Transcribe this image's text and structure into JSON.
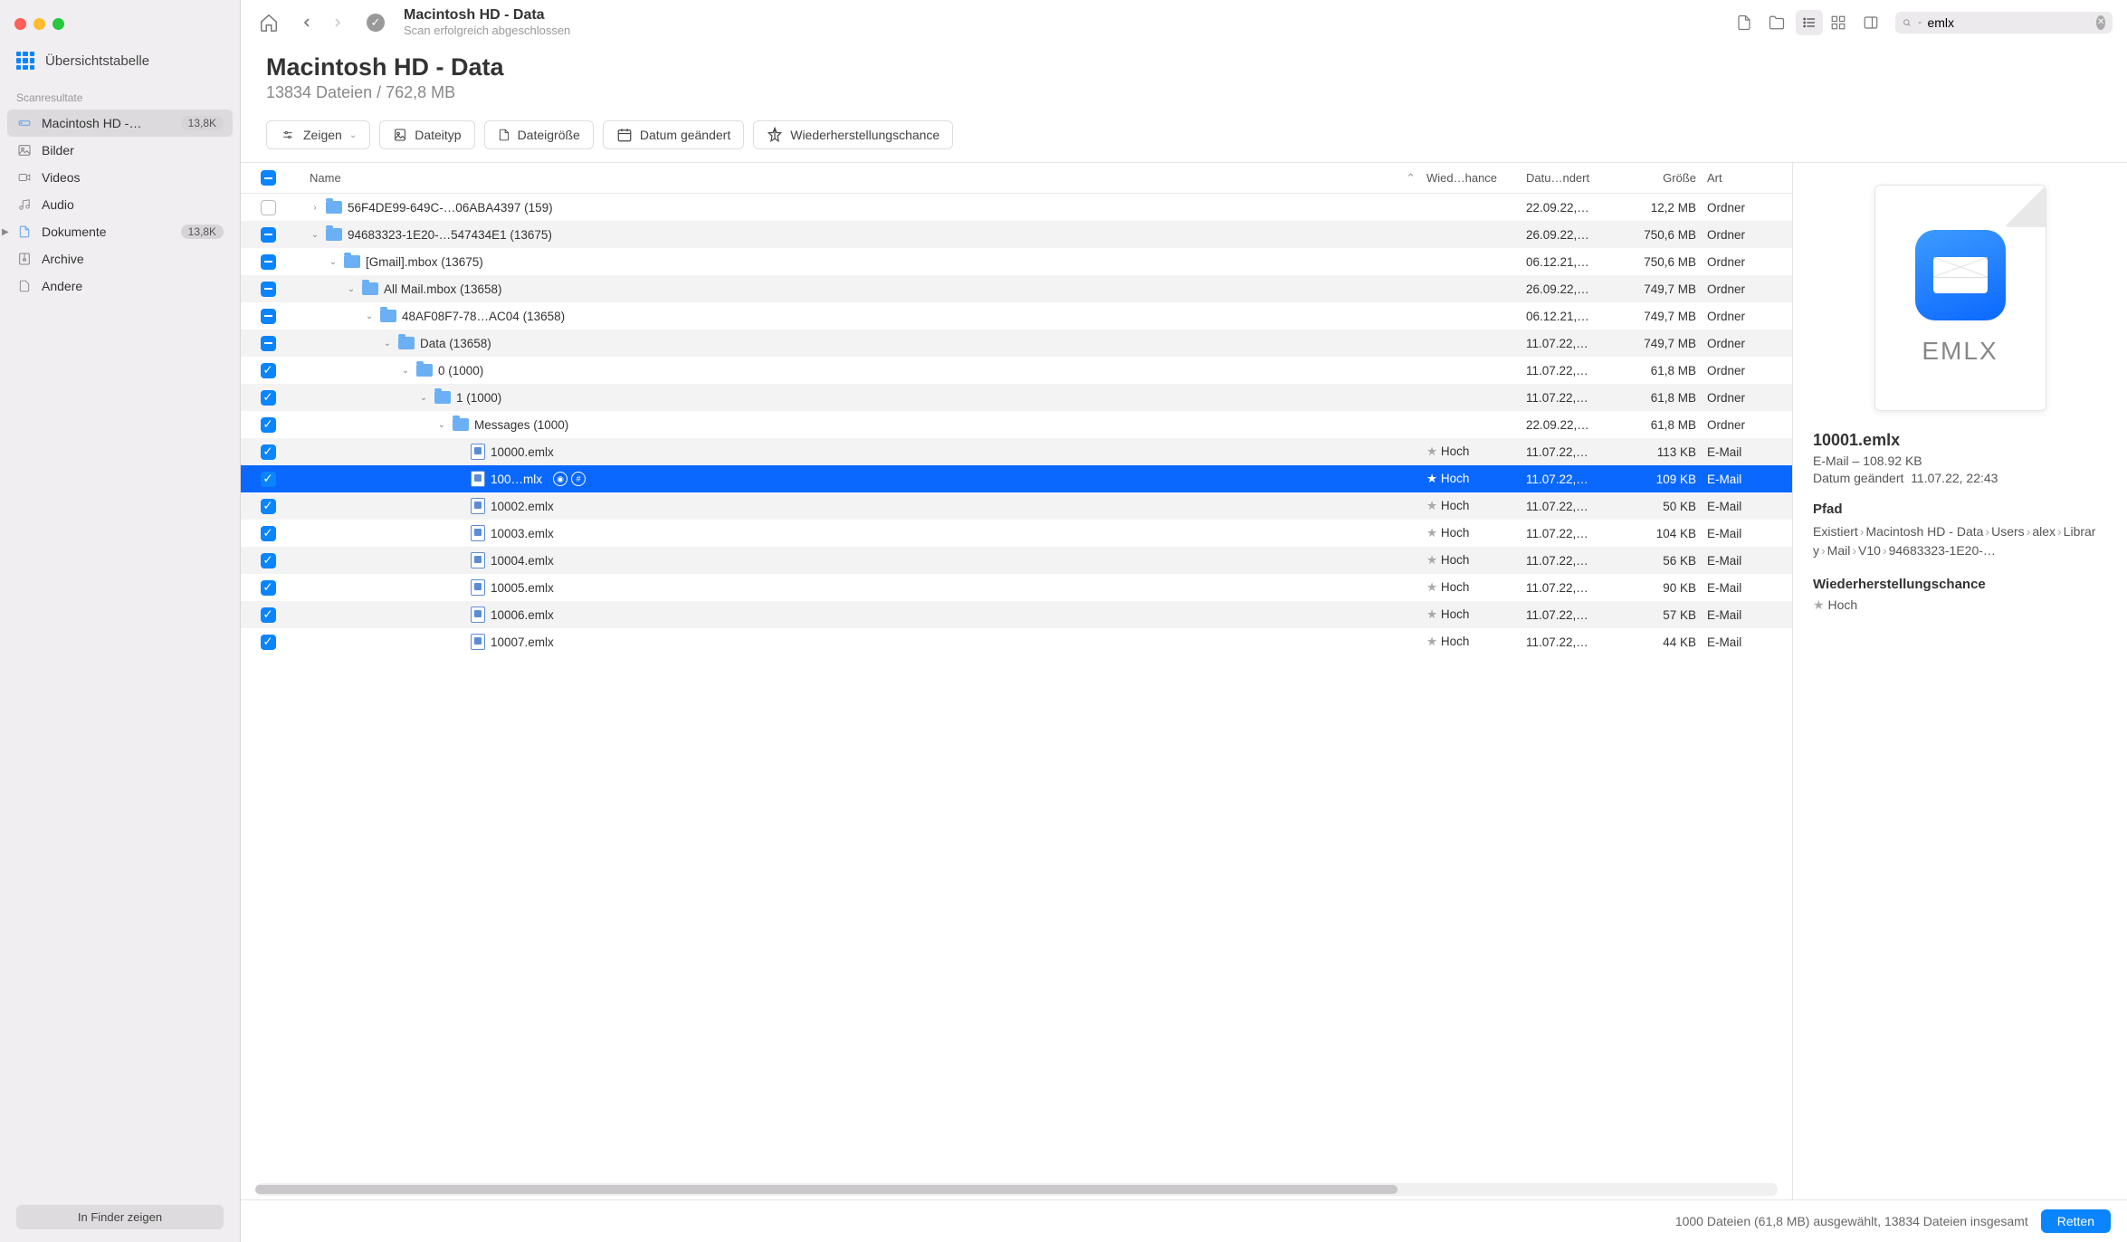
{
  "sidebar": {
    "top_label": "Übersichtstabelle",
    "section_label": "Scanresultate",
    "items": [
      {
        "label": "Macintosh HD -…",
        "badge": "13,8K",
        "icon": "drive",
        "selected": true
      },
      {
        "label": "Bilder",
        "icon": "image"
      },
      {
        "label": "Videos",
        "icon": "video"
      },
      {
        "label": "Audio",
        "icon": "audio"
      },
      {
        "label": "Dokumente",
        "badge": "13,8K",
        "icon": "doc",
        "expandable": true
      },
      {
        "label": "Archive",
        "icon": "archive"
      },
      {
        "label": "Andere",
        "icon": "other"
      }
    ],
    "finder_btn": "In Finder zeigen"
  },
  "toolbar": {
    "title": "Macintosh HD - Data",
    "subtitle": "Scan erfolgreich abgeschlossen",
    "search_value": "emlx"
  },
  "header": {
    "title": "Macintosh HD - Data",
    "subtitle": "13834 Dateien / 762,8 MB"
  },
  "filters": {
    "show": "Zeigen",
    "filetype": "Dateityp",
    "filesize": "Dateigröße",
    "modified": "Datum geändert",
    "chance": "Wiederherstellungschance"
  },
  "columns": {
    "name": "Name",
    "chance": "Wied…hance",
    "date": "Datu…ndert",
    "size": "Größe",
    "type": "Art"
  },
  "rows": [
    {
      "chk": "empty",
      "indent": 0,
      "disc": "right",
      "icon": "folder",
      "name": "56F4DE99-649C-…06ABA4397 (159)",
      "date": "22.09.22,…",
      "size": "12,2 MB",
      "type": "Ordner",
      "alt": false
    },
    {
      "chk": "partial",
      "indent": 0,
      "disc": "down",
      "icon": "folder",
      "name": "94683323-1E20-…547434E1 (13675)",
      "date": "26.09.22,…",
      "size": "750,6 MB",
      "type": "Ordner",
      "alt": true
    },
    {
      "chk": "partial",
      "indent": 1,
      "disc": "down",
      "icon": "folder",
      "name": "[Gmail].mbox (13675)",
      "date": "06.12.21,…",
      "size": "750,6 MB",
      "type": "Ordner",
      "alt": false
    },
    {
      "chk": "partial",
      "indent": 2,
      "disc": "down",
      "icon": "folder",
      "name": "All Mail.mbox (13658)",
      "date": "26.09.22,…",
      "size": "749,7 MB",
      "type": "Ordner",
      "alt": true
    },
    {
      "chk": "partial",
      "indent": 3,
      "disc": "down",
      "icon": "folder",
      "name": "48AF08F7-78…AC04 (13658)",
      "date": "06.12.21,…",
      "size": "749,7 MB",
      "type": "Ordner",
      "alt": false
    },
    {
      "chk": "partial",
      "indent": 4,
      "disc": "down",
      "icon": "folder",
      "name": "Data (13658)",
      "date": "11.07.22,…",
      "size": "749,7 MB",
      "type": "Ordner",
      "alt": true
    },
    {
      "chk": "checked",
      "indent": 5,
      "disc": "down",
      "icon": "folder",
      "name": "0 (1000)",
      "date": "11.07.22,…",
      "size": "61,8 MB",
      "type": "Ordner",
      "alt": false
    },
    {
      "chk": "checked",
      "indent": 6,
      "disc": "down",
      "icon": "folder",
      "name": "1 (1000)",
      "date": "11.07.22,…",
      "size": "61,8 MB",
      "type": "Ordner",
      "alt": true
    },
    {
      "chk": "checked",
      "indent": 7,
      "disc": "down",
      "icon": "folder",
      "name": "Messages (1000)",
      "date": "22.09.22,…",
      "size": "61,8 MB",
      "type": "Ordner",
      "alt": false
    },
    {
      "chk": "checked",
      "indent": 8,
      "icon": "file",
      "name": "10000.emlx",
      "chance": "Hoch",
      "date": "11.07.22,…",
      "size": "113 KB",
      "type": "E-Mail",
      "alt": true
    },
    {
      "chk": "checked",
      "indent": 8,
      "icon": "file",
      "name": "100…mlx",
      "chance": "Hoch",
      "date": "11.07.22,…",
      "size": "109 KB",
      "type": "E-Mail",
      "selected": true,
      "tags": true
    },
    {
      "chk": "checked",
      "indent": 8,
      "icon": "file",
      "name": "10002.emlx",
      "chance": "Hoch",
      "date": "11.07.22,…",
      "size": "50 KB",
      "type": "E-Mail",
      "alt": true
    },
    {
      "chk": "checked",
      "indent": 8,
      "icon": "file",
      "name": "10003.emlx",
      "chance": "Hoch",
      "date": "11.07.22,…",
      "size": "104 KB",
      "type": "E-Mail",
      "alt": false
    },
    {
      "chk": "checked",
      "indent": 8,
      "icon": "file",
      "name": "10004.emlx",
      "chance": "Hoch",
      "date": "11.07.22,…",
      "size": "56 KB",
      "type": "E-Mail",
      "alt": true
    },
    {
      "chk": "checked",
      "indent": 8,
      "icon": "file",
      "name": "10005.emlx",
      "chance": "Hoch",
      "date": "11.07.22,…",
      "size": "90 KB",
      "type": "E-Mail",
      "alt": false
    },
    {
      "chk": "checked",
      "indent": 8,
      "icon": "file",
      "name": "10006.emlx",
      "chance": "Hoch",
      "date": "11.07.22,…",
      "size": "57 KB",
      "type": "E-Mail",
      "alt": true
    },
    {
      "chk": "checked",
      "indent": 8,
      "icon": "file",
      "name": "10007.emlx",
      "chance": "Hoch",
      "date": "11.07.22,…",
      "size": "44 KB",
      "type": "E-Mail",
      "alt": false
    }
  ],
  "detail": {
    "preview_label": "EMLX",
    "filename": "10001.emlx",
    "meta_line": "E-Mail – 108.92 KB",
    "modified_label": "Datum geändert",
    "modified_value": "11.07.22, 22:43",
    "path_label": "Pfad",
    "path_crumbs": [
      "Existiert",
      "Macintosh HD - Data",
      "Users",
      "alex",
      "Library",
      "Mail",
      "V10",
      "94683323-1E20-…"
    ],
    "chance_label": "Wiederherstellungschance",
    "chance_value": "Hoch"
  },
  "statusbar": {
    "text": "1000 Dateien (61,8 MB) ausgewählt, 13834 Dateien insgesamt",
    "button": "Retten"
  }
}
